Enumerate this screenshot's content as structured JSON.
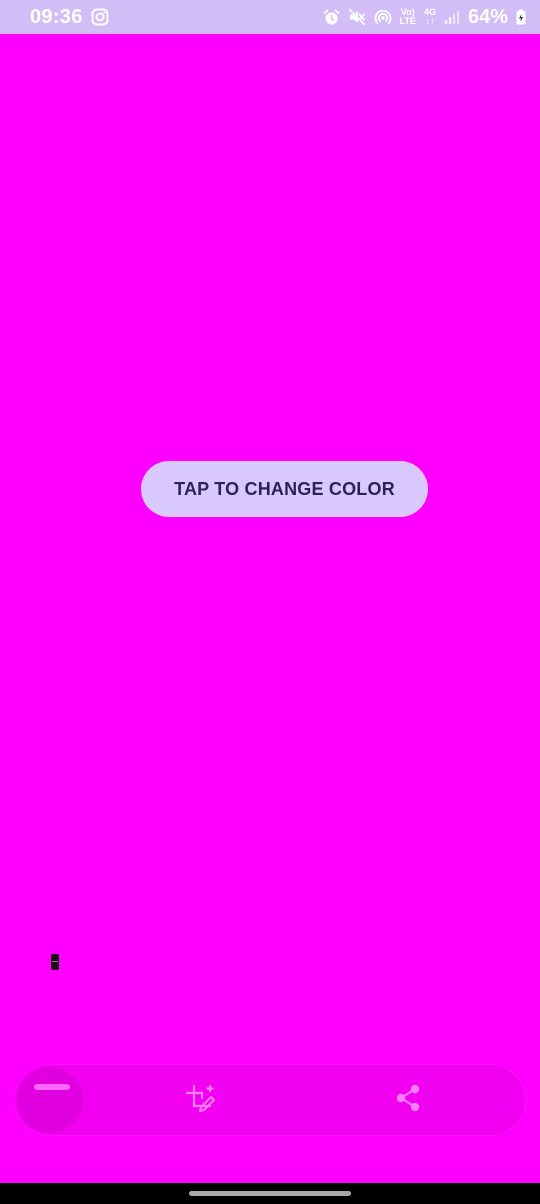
{
  "status_bar": {
    "time": "09:36",
    "battery_percent": "64%",
    "volte_label_top": "Vo)",
    "volte_label_bottom": "LTE",
    "network_label": "4G",
    "icons": [
      "instagram-icon",
      "alarm-icon",
      "mute-icon",
      "hotspot-icon",
      "volte-icon",
      "network-4g-icon",
      "signal-icon",
      "battery-icon"
    ]
  },
  "main": {
    "background_color": "#ff00ff",
    "button_label": "TAP TO CHANGE COLOR",
    "button_color": "#d9c8fb"
  },
  "toolbar": {
    "icons": [
      "drag-handle-icon",
      "crop-edit-icon",
      "share-icon"
    ]
  }
}
